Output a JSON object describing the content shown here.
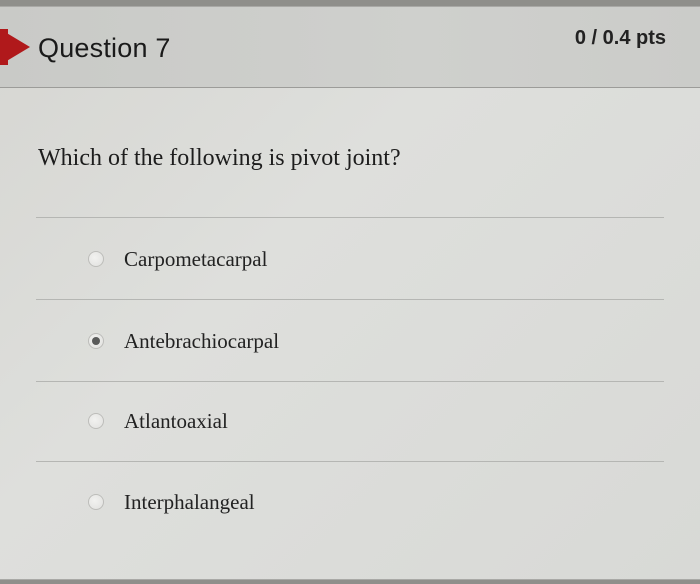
{
  "question": {
    "title": "Question 7",
    "points": "0 / 0.4 pts",
    "text": "Which of the following is pivot joint?",
    "marker_color": "#b0191b",
    "answers": [
      {
        "label": "Carpometacarpal",
        "selected": false
      },
      {
        "label": "Antebrachiocarpal",
        "selected": true
      },
      {
        "label": "Atlantoaxial",
        "selected": false
      },
      {
        "label": "Interphalangeal",
        "selected": false
      }
    ]
  }
}
